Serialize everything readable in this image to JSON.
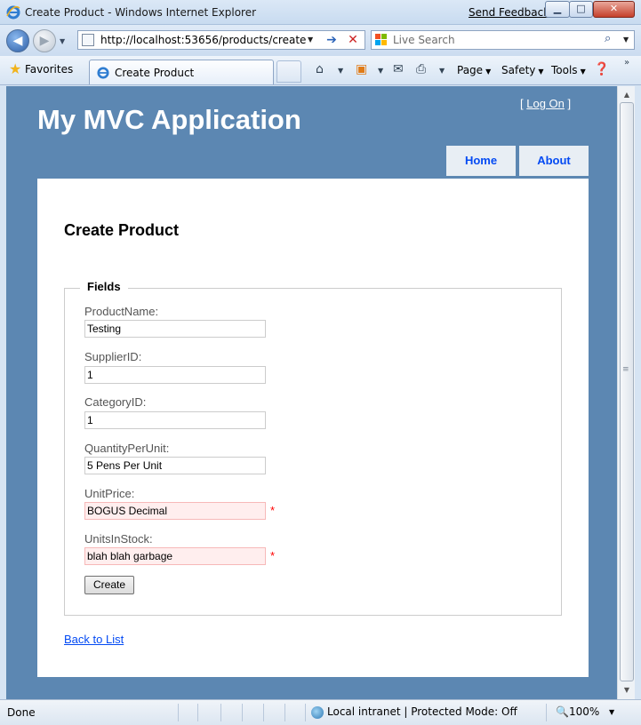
{
  "window": {
    "title": "Create Product - Windows Internet Explorer",
    "feedback": "Send Feedback",
    "minimize": "▁",
    "maximize": "□",
    "close": "✕"
  },
  "addressbar": {
    "url": "http://localhost:53656/products/create",
    "search_placeholder": "Live Search"
  },
  "commandbar": {
    "favorites": "Favorites",
    "tab_title": "Create Product",
    "page": "Page",
    "safety": "Safety",
    "tools": "Tools"
  },
  "site": {
    "login_open": "[",
    "login_link": "Log On",
    "login_close": "]",
    "title": "My MVC Application",
    "menu": [
      "Home",
      "About"
    ]
  },
  "form": {
    "heading": "Create Product",
    "legend": "Fields",
    "fields": [
      {
        "label": "ProductName:",
        "value": "Testing",
        "error": false
      },
      {
        "label": "SupplierID:",
        "value": "1",
        "error": false
      },
      {
        "label": "CategoryID:",
        "value": "1",
        "error": false
      },
      {
        "label": "QuantityPerUnit:",
        "value": "5 Pens Per Unit",
        "error": false
      },
      {
        "label": "UnitPrice:",
        "value": "BOGUS Decimal",
        "error": true
      },
      {
        "label": "UnitsInStock:",
        "value": "blah blah garbage",
        "error": true
      }
    ],
    "error_marker": "*",
    "submit": "Create",
    "back_link": "Back to List"
  },
  "status": {
    "text": "Done",
    "zone": "Local intranet | Protected Mode: Off",
    "zoom": "100%"
  },
  "colors": {
    "page_bg": "#5c87b2",
    "menu_text": "#034af3",
    "error_bg": "#ffeeee",
    "error_marker": "#ff0000"
  }
}
